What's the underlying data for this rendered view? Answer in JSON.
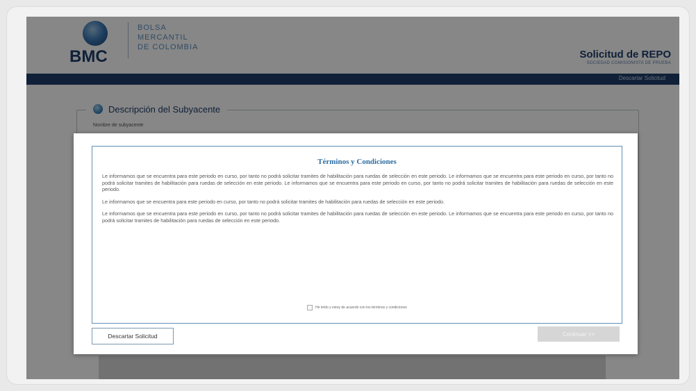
{
  "header": {
    "logo_abbr": "BMC",
    "logo_lines": [
      "BOLSA",
      "MERCANTIL",
      "DE COLOMBIA"
    ],
    "title": "Solicitud de REPO",
    "subtitle": "SOCIEDAD COMISIONISTA DE PRUEBA"
  },
  "nav": {
    "discard_link": "Descartar Solicitud"
  },
  "section": {
    "legend": "Descripción del Subyacente",
    "field_label": "Nombre de subyacente"
  },
  "modal": {
    "title": "Términos y Condiciones",
    "paragraphs": [
      "Le informamos que se encuentra para este periodo en curso, por tanto no podrá solicitar tramites de habilitación para ruedas de selección en este periodo. Le informamos que se encuentra para este periodo en curso, por tanto no podrá solicitar tramites de habilitación para ruedas de selección en este periodo. Le informamos que se encuentra para este periodo en curso, por tanto no podrá solicitar tramites de habilitación para ruedas de selección en este periodo.",
      "Le informamos que se encuentra para este periodo en curso, por tanto no podrá solicitar tramites de habilitación para ruedas de selección en este periodo.",
      "Le informamos que se encuentra para este periodo en curso, por tanto no podrá solicitar tramites de habilitación para ruedas de selección en este periodo. Le informamos que se encuentra para este periodo en curso, por tanto no podrá solicitar tramites de habilitación para ruedas de selección en este periodo."
    ],
    "agree_label": "He leído y estoy de acuerdo con los términos y condiciones",
    "discard_button": "Descartar Solicitud",
    "continue_button": "Continuar >>"
  },
  "colors": {
    "brand_navy": "#1f3e6b",
    "brand_light_blue": "#5b8fbf",
    "title_blue": "#2d6da3",
    "modal_border": "#5f8fb5"
  }
}
